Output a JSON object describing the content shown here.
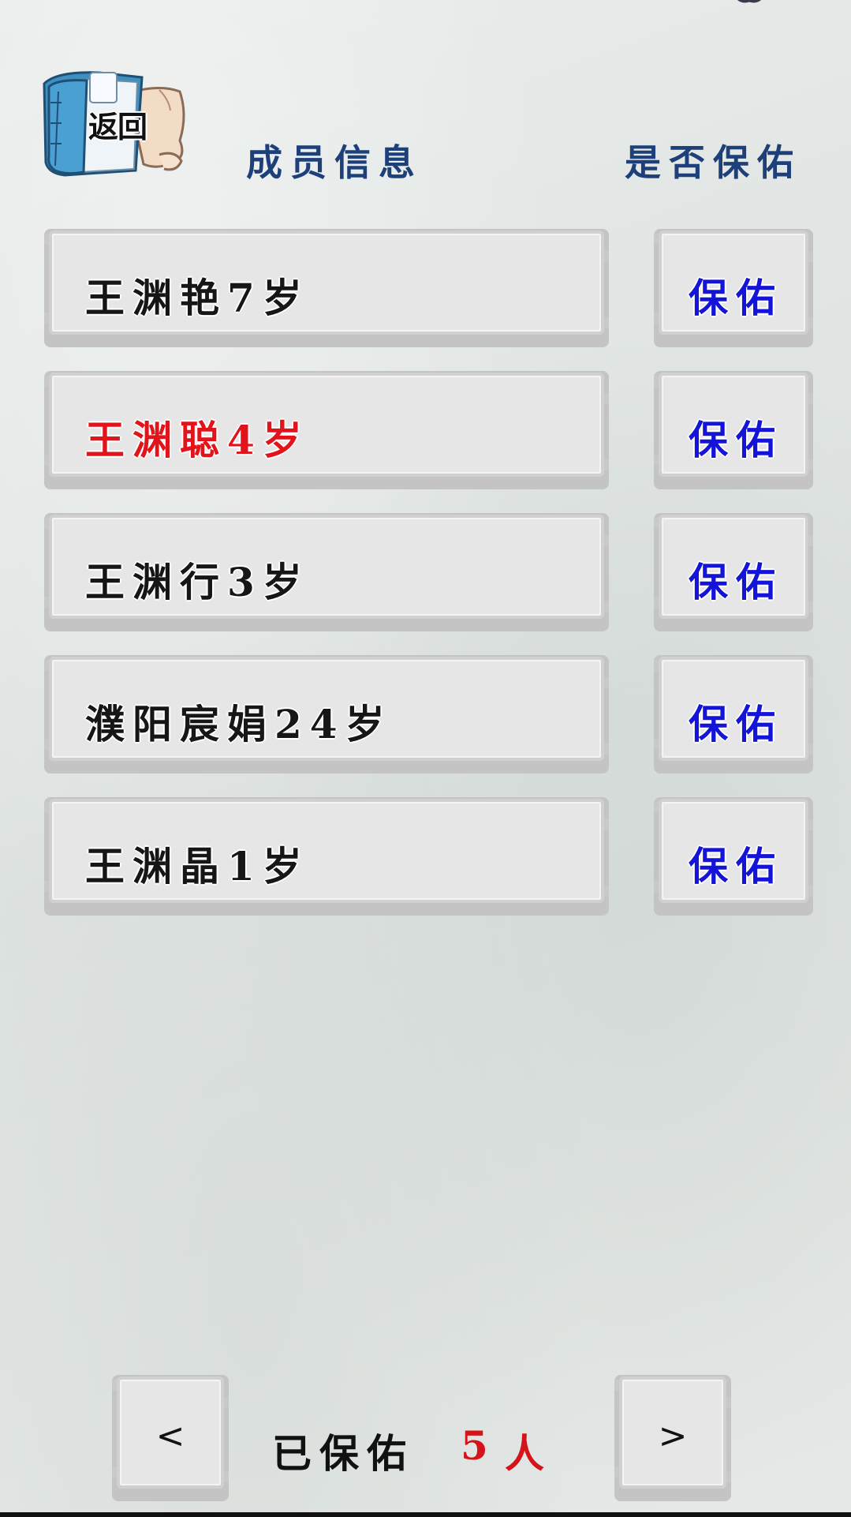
{
  "header": {
    "back_label": "返回",
    "members_title": "成员信息",
    "protect_title": "是否保佑"
  },
  "members": [
    {
      "name": "王渊艳7岁",
      "highlighted": false,
      "action_label": "保佑"
    },
    {
      "name": "王渊聪4岁",
      "highlighted": true,
      "action_label": "保佑"
    },
    {
      "name": "王渊行3岁",
      "highlighted": false,
      "action_label": "保佑"
    },
    {
      "name": "濮阳宸娟24岁",
      "highlighted": false,
      "action_label": "保佑"
    },
    {
      "name": "王渊晶1岁",
      "highlighted": false,
      "action_label": "保佑"
    }
  ],
  "footer": {
    "prev_label": "<",
    "next_label": ">",
    "status_label": "已保佑",
    "count": "5",
    "unit": "人"
  },
  "colors": {
    "header_text": "#1d3f7a",
    "protect_text": "#1414d8",
    "highlight_text": "#e0141a",
    "count_text": "#d4141a"
  }
}
